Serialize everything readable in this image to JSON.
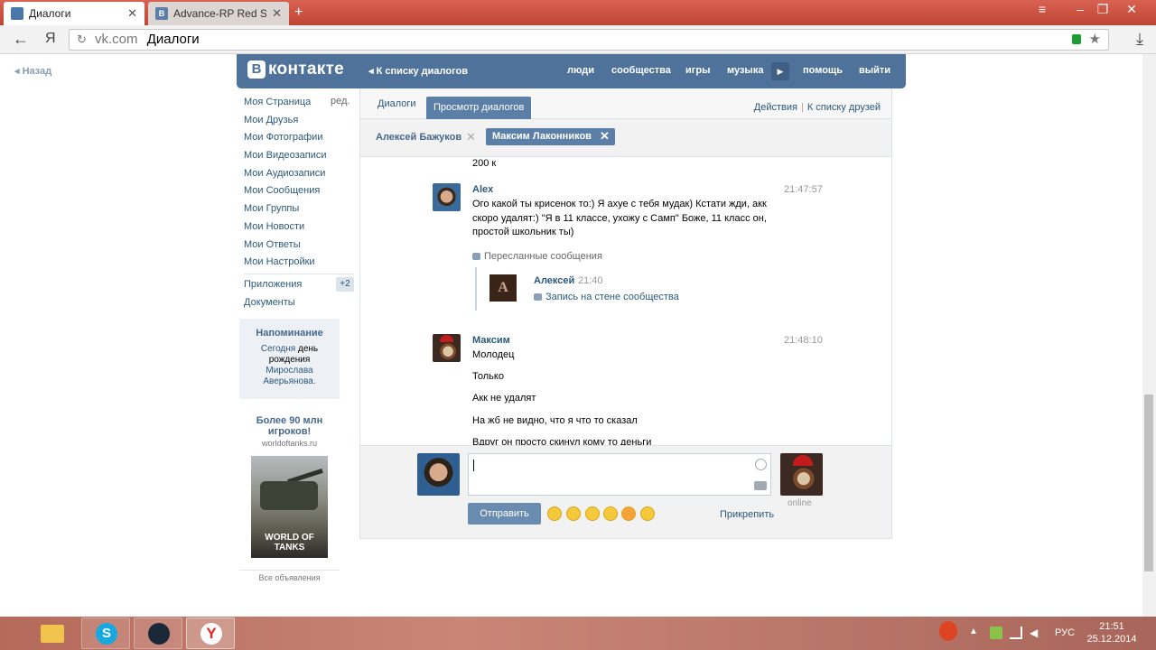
{
  "browser": {
    "tabs": [
      {
        "label": "Диалоги"
      },
      {
        "label": "Advance-RP Red Server",
        "favicon": "B"
      }
    ],
    "url_domain": "vk.com",
    "url_title": "Диалоги",
    "new_tab_glyph": "+",
    "back_glyph": "←",
    "yandex_glyph": "Я"
  },
  "vk": {
    "nazad": "Назад",
    "logo_letter": "В",
    "logo_text": "контакте",
    "back_to_list": "К списку диалогов",
    "nav": [
      "люди",
      "сообщества",
      "игры",
      "музыка",
      "помощь",
      "выйти"
    ],
    "menu": [
      "Моя Страница",
      "Мои Друзья",
      "Мои Фотографии",
      "Мои Видеозаписи",
      "Мои Аудиозаписи",
      "Мои Сообщения",
      "Мои Группы",
      "Мои Новости",
      "Мои Ответы",
      "Мои Настройки"
    ],
    "red_link": "ред.",
    "apps": "Приложения",
    "apps_badge": "+2",
    "docs": "Документы",
    "reminder": {
      "title": "Напоминание",
      "line1_a": "Сегодня",
      "line1_b": "день",
      "line2": "рождения",
      "line3": "Мирослава",
      "line4": "Аверьянова."
    },
    "ad": {
      "title": "Более 90 млн игроков!",
      "domain": "worldoftanks.ru",
      "image_text": "WORLD OF TANKS",
      "all": "Все объявления"
    },
    "dialog_tabs": [
      "Диалоги",
      "Просмотр диалогов"
    ],
    "actions": "Действия",
    "actions_sep": "|",
    "friends_list": "К списку друзей",
    "people": [
      "Алексей Бажуков",
      "Максим Лаконников"
    ],
    "close_glyph": "✕",
    "messages": {
      "prev_text": "200 к",
      "m1": {
        "author": "Alex",
        "time": "21:47:57",
        "lines": [
          "Ого какой ты крисенок то:) Я ахуе с тебя мудак) Кстати жди, акк",
          "скоро удалят:) \"Я в 11 классе, ухожу с Самп\" Боже, 11 класс он,",
          "простой школьник ты)"
        ],
        "forwarded_label": "Пересланные сообщения",
        "forwarded_avatar_letter": "А",
        "forwarded_author": "Алексей",
        "forwarded_time": "21:40",
        "forwarded_content": "Запись на стене сообщества"
      },
      "m2": {
        "author": "Максим",
        "time": "21:48:10",
        "lines": [
          "Молодец",
          "Только",
          "Акк не удалят",
          "На жб не видно, что я что то сказал",
          "Вдруг он просто скинул кому то деньги"
        ]
      }
    },
    "composer": {
      "send": "Отправить",
      "attach": "Прикрепить",
      "online": "online"
    }
  },
  "taskbar": {
    "lang": "РУС",
    "time": "21:51",
    "date": "25.12.2014",
    "skype_glyph": "S",
    "yandex_glyph": "Y"
  }
}
